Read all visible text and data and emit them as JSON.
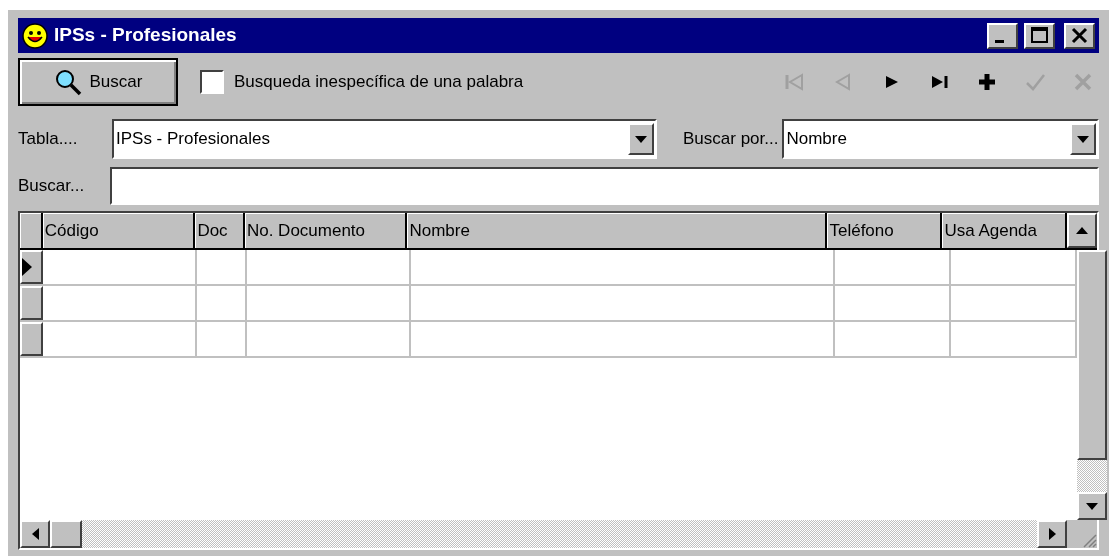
{
  "window": {
    "title": "IPSs - Profesionales"
  },
  "toolbar": {
    "search_button": "Buscar",
    "checkbox": {
      "label": "Busqueda inespecífica de una palabra",
      "checked": false
    },
    "nav_buttons": [
      {
        "kind": "first",
        "disabled": true
      },
      {
        "kind": "prev",
        "disabled": true
      },
      {
        "kind": "next",
        "disabled": false
      },
      {
        "kind": "last",
        "disabled": false
      },
      {
        "kind": "add",
        "disabled": false
      },
      {
        "kind": "confirm",
        "disabled": true
      },
      {
        "kind": "cancel",
        "disabled": true
      }
    ]
  },
  "filters": {
    "table_label": "Tabla....",
    "table_value": "IPSs - Profesionales",
    "search_by_label": "Buscar por...",
    "search_by_value": "Nombre",
    "search_label": "Buscar..."
  },
  "grid": {
    "columns": [
      "Código",
      "Doc",
      "No. Documento",
      "Nombre",
      "Teléfono",
      "Usa Agenda"
    ],
    "rows": [
      {
        "current": true
      },
      {
        "current": false
      },
      {
        "current": false
      }
    ]
  }
}
